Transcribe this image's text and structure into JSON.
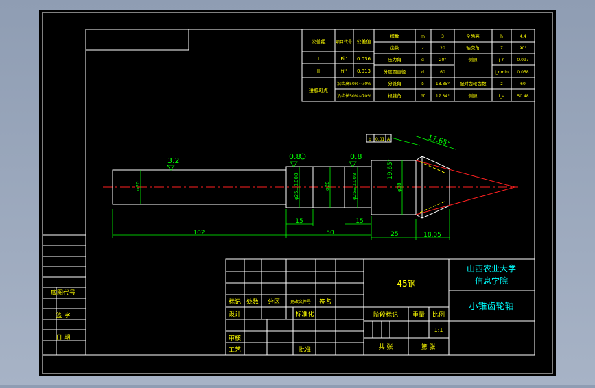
{
  "colors": {
    "background": "#000000",
    "frame": "#ffffff",
    "dims": "#00ff00",
    "text": "#ffff00",
    "title": "#00ffff",
    "center": "#ff0000"
  },
  "params": {
    "headers": [
      "公差组",
      "项目代号",
      "公差值"
    ],
    "rows": [
      [
        "I",
        "Fi''",
        "0.036"
      ],
      [
        "II",
        "fi''",
        "0.013"
      ]
    ],
    "contact_label": "接触斑点",
    "contact_values": [
      "沿齿高50%~70%",
      "沿齿长50%~70%"
    ],
    "col2": [
      [
        "模数",
        "m",
        "3"
      ],
      [
        "齿数",
        "z",
        "20"
      ],
      [
        "压力角",
        "α",
        "20°"
      ],
      [
        "分度圆直径",
        "d",
        "60"
      ],
      [
        "分锥角",
        "δ",
        "18.85°"
      ],
      [
        "根锥角",
        "δf",
        "17.34°"
      ]
    ],
    "col3": [
      [
        "全齿高",
        "h",
        "4.4"
      ],
      [
        "轴交角",
        "Σ",
        "90°"
      ],
      [
        "侧隙",
        "j_n",
        "0.097"
      ],
      [
        "",
        "j_nmin",
        "0.058"
      ],
      [
        "配对齿轮齿数",
        "z",
        "60"
      ],
      [
        "侧隙",
        "f_a",
        "50.48"
      ]
    ]
  },
  "dims": {
    "d102": "102",
    "d50": "50",
    "d15a": "15",
    "d15b": "15",
    "d25": "25",
    "d1805": "18.05",
    "angle": "17.65°",
    "angle2": "19.65°",
    "r32": "3.2",
    "r08a": "0.8",
    "r08b": "0.8",
    "dia_l": "φ20",
    "dia_m1": "φ25±0.008",
    "dia_m2": "φ28",
    "dia_m3": "φ25±0.008",
    "dia_r": "φ38",
    "tol_box": [
      "b",
      "0.01",
      "A"
    ]
  },
  "title_block": {
    "material": "45钢",
    "school_line1": "山西农业大学",
    "school_line2": "信息学院",
    "part_name": "小锥齿轮轴",
    "row_labels": [
      "标记",
      "处数",
      "分区",
      "更改文件号",
      "签名"
    ],
    "design": "设计",
    "standardize": "标准化",
    "review": "审核",
    "process": "工艺",
    "approve": "批准",
    "stage_mark": "阶段标记",
    "weight": "重量",
    "scale": "比例",
    "scale_value": "1:1",
    "sheets": "共 张",
    "sheet_no": "第 张"
  },
  "left_strip": [
    "底图代号",
    "签 字",
    "日 期"
  ]
}
